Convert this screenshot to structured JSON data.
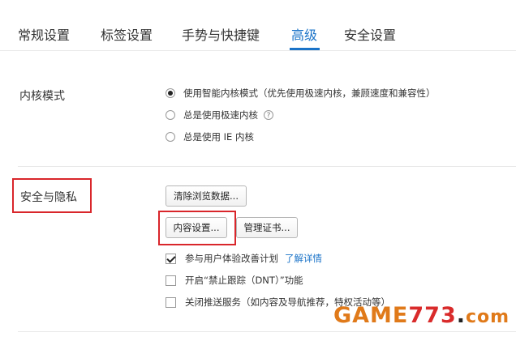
{
  "tabs": [
    {
      "label": "常规设置",
      "active": false
    },
    {
      "label": "标签设置",
      "active": false
    },
    {
      "label": "手势与快捷键",
      "active": false
    },
    {
      "label": "高级",
      "active": true
    },
    {
      "label": "安全设置",
      "active": false
    }
  ],
  "kernel": {
    "label": "内核模式",
    "options": [
      {
        "label": "使用智能内核模式（优先使用极速内核，兼顾速度和兼容性）",
        "checked": true
      },
      {
        "label": "总是使用极速内核",
        "checked": false,
        "help": "?"
      },
      {
        "label": "总是使用 IE 内核",
        "checked": false
      }
    ]
  },
  "privacy": {
    "label": "安全与隐私",
    "clear_button": "清除浏览数据...",
    "content_button": "内容设置...",
    "cert_button": "管理证书...",
    "checks": [
      {
        "label": "参与用户体验改善计划",
        "checked": true,
        "link": "了解详情"
      },
      {
        "label": "开启“禁止跟踪（DNT）”功能",
        "checked": false
      },
      {
        "label": "关闭推送服务（如内容及导航推荐，特权活动等）",
        "checked": false
      }
    ]
  },
  "watermark": {
    "game": "GAME",
    "num": "773",
    "dot": ".",
    "com": "com"
  },
  "colors": {
    "accent": "#1a73c8",
    "highlight": "#d9262b"
  }
}
